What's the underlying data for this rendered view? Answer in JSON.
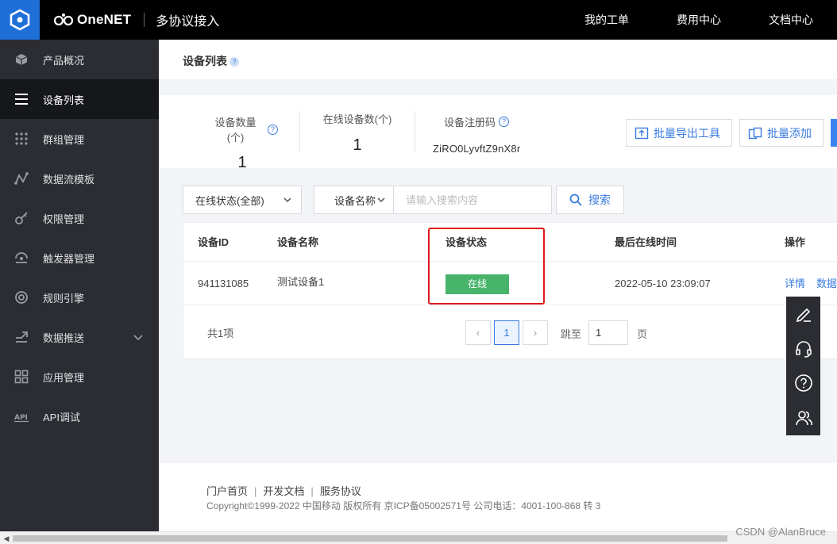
{
  "header": {
    "brand_name": "OneNET",
    "brand_sub": "多协议接入",
    "nav": [
      "我的工单",
      "费用中心",
      "文档中心"
    ]
  },
  "sidebar": {
    "items": [
      {
        "label": "产品概况",
        "icon": "cube-icon"
      },
      {
        "label": "设备列表",
        "icon": "list-icon",
        "active": true
      },
      {
        "label": "群组管理",
        "icon": "dots-grid-icon"
      },
      {
        "label": "数据流模板",
        "icon": "graph-icon"
      },
      {
        "label": "权限管理",
        "icon": "key-icon"
      },
      {
        "label": "触发器管理",
        "icon": "trigger-icon"
      },
      {
        "label": "规则引擎",
        "icon": "target-icon"
      },
      {
        "label": "数据推送",
        "icon": "push-icon",
        "expandable": true
      },
      {
        "label": "应用管理",
        "icon": "apps-icon"
      },
      {
        "label": "API调试",
        "icon": "api-icon"
      }
    ]
  },
  "page": {
    "title": "设备列表",
    "help": "?"
  },
  "stats": {
    "device_count_label": "设备数量(个)",
    "device_count": "1",
    "online_count_label": "在线设备数(个)",
    "online_count": "1",
    "reg_code_label": "设备注册码",
    "reg_code": "ZiRO0LyvftZ9nX8r",
    "export_label": "批量导出工具",
    "batch_add_label": "批量添加"
  },
  "filter": {
    "status_select": "在线状态(全部)",
    "field_select": "设备名称",
    "search_placeholder": "请输入搜索内容",
    "search_label": "搜索"
  },
  "table": {
    "columns": [
      "设备ID",
      "设备名称",
      "设备状态",
      "最后在线时间",
      "操作"
    ],
    "rows": [
      {
        "id": "941131085",
        "name": "测试设备1",
        "status": "在线",
        "last_online": "2022-05-10 23:09:07",
        "actions": [
          "详情",
          "数据流"
        ]
      }
    ]
  },
  "pagination": {
    "total": "共1项",
    "prev": "‹",
    "current": "1",
    "next": "›",
    "jump_label": "跳至",
    "jump_value": "1",
    "page_suffix": "页"
  },
  "footer": {
    "links": [
      "门户首页",
      "开发文档",
      "服务协议"
    ],
    "copyright": "Copyright©1999-2022 中国移动 版权所有 京ICP备05002571号 公司电话：4001-100-868 转 3"
  },
  "float_toolbar": [
    "edit-icon",
    "headset-icon",
    "help-circle-icon",
    "users-icon"
  ],
  "watermark": "CSDN @AlanBruce",
  "colors": {
    "accent": "#3a7be0",
    "status_online": "#48b46b",
    "sidebar_bg": "#2b2d33",
    "highlight": "#e0191e"
  }
}
